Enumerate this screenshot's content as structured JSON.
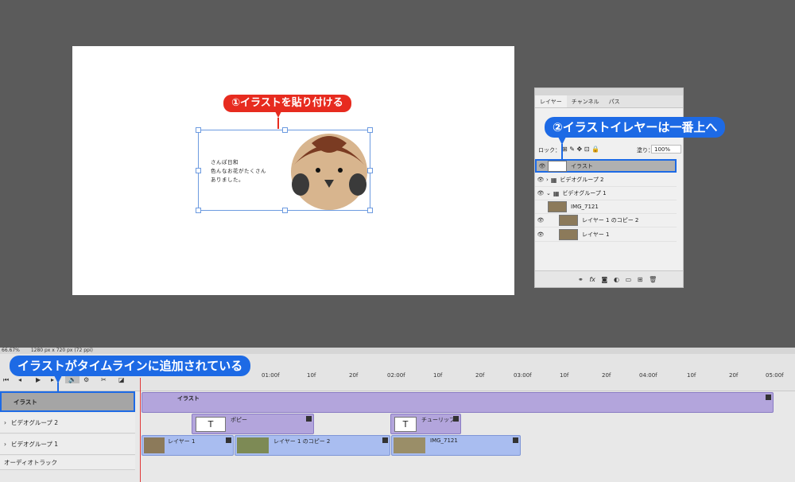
{
  "canvas": {
    "note_lines": [
      "さんぽ日和",
      "色んなお花がたくさん",
      "ありました。"
    ]
  },
  "callouts": {
    "paste": "①イラストを貼り付ける",
    "top_layer": "②イラストイレヤーは一番上へ",
    "timeline": "イラストがタイムラインに追加されている"
  },
  "layers_panel": {
    "tabs": [
      "レイヤー",
      "チャンネル",
      "パス"
    ],
    "lock_label": "ロック：",
    "fill_label": "塗り：",
    "fill_value": "100%",
    "layers": [
      {
        "name": "イラスト",
        "selected": true
      },
      {
        "name": "ビデオグループ 2",
        "selected": false
      },
      {
        "name": "ビデオグループ 1",
        "selected": false
      },
      {
        "name": "IMG_7121",
        "selected": false
      },
      {
        "name": "レイヤー 1 のコピー 2",
        "selected": false
      },
      {
        "name": "レイヤー 1",
        "selected": false
      }
    ]
  },
  "status": {
    "zoom": "66.67%",
    "doc_size": "1280 px x 720 px (72 ppi)"
  },
  "timeline": {
    "ruler": [
      "01:00f",
      "10f",
      "20f",
      "02:00f",
      "10f",
      "20f",
      "03:00f",
      "10f",
      "20f",
      "04:00f",
      "10f",
      "20f",
      "05:00f"
    ],
    "tracks": [
      {
        "name": "イラスト"
      },
      {
        "name": "ビデオグループ 2"
      },
      {
        "name": "ビデオグループ 1"
      },
      {
        "name": "オーディオトラック"
      }
    ],
    "clips": {
      "illust": "イラスト",
      "poppy": "ポピー",
      "tulip": "チューリップ",
      "layer1": "レイヤー 1",
      "layer1copy2": "レイヤー 1 のコピー 2",
      "img": "IMG_7121"
    },
    "t_glyph": "T"
  },
  "colors": {
    "accent_red": "#e72b1f",
    "accent_blue": "#1d6ae5",
    "clip_purple": "#b3a5dc",
    "clip_blue": "#a9bdf0"
  }
}
